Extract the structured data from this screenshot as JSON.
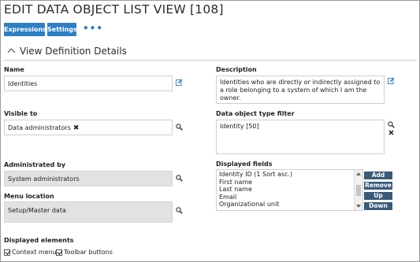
{
  "title": "EDIT DATA OBJECT LIST VIEW [108]",
  "toolbar": {
    "expressions_label": "Expressions",
    "settings_label": "Settings",
    "more_label": "•••"
  },
  "section": {
    "title": "View Definition Details"
  },
  "fields": {
    "name": {
      "label": "Name",
      "value": "Identities"
    },
    "description": {
      "label": "Description",
      "value": "Identities who are directly or indirectly assigned to a role belonging to a system of which I am the owner."
    },
    "visible_to": {
      "label": "Visible to",
      "value": "Data administrators",
      "remove_glyph": "✖"
    },
    "type_filter": {
      "label": "Data object type filter",
      "value": "Identity [50]"
    },
    "administrated_by": {
      "label": "Administrated by",
      "value": "System administrators"
    },
    "menu_location": {
      "label": "Menu location",
      "value": "Setup/Master data"
    },
    "displayed_fields": {
      "label": "Displayed fields",
      "items": [
        "Identity ID (1 Sort asc.)",
        "First name",
        "Last name",
        "Email",
        "Organizational unit"
      ],
      "buttons": {
        "add": "Add",
        "remove": "Remove",
        "up": "Up",
        "down": "Down"
      }
    },
    "displayed_elements": {
      "label": "Displayed elements",
      "context_menu": "Context menu",
      "toolbar_buttons": "Toolbar buttons"
    }
  },
  "colors": {
    "accent": "#2e7fc4",
    "side_button": "#3a5a7a",
    "readonly_bg": "#e2e2e2"
  }
}
